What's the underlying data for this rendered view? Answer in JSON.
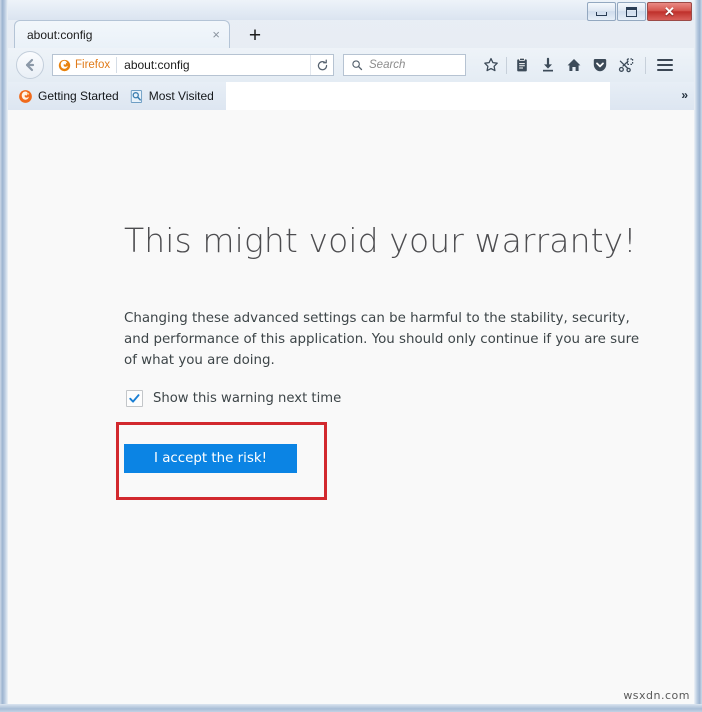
{
  "window": {
    "minimize_label": "Minimize",
    "maximize_label": "Maximize",
    "close_label": "✕"
  },
  "tabs": [
    {
      "title": "about:config",
      "close_glyph": "×"
    }
  ],
  "newtab_glyph": "+",
  "toolbar": {
    "back_label": "Back",
    "identity_label": "Firefox",
    "url_value": "about:config",
    "reload_glyph": "⟳",
    "search_placeholder": "Search",
    "icons": [
      {
        "name": "bookmark-star-icon",
        "label": "Bookmark this page"
      },
      {
        "name": "reading-list-icon",
        "label": "Reading list"
      },
      {
        "name": "downloads-icon",
        "label": "Downloads"
      },
      {
        "name": "home-icon",
        "label": "Home"
      },
      {
        "name": "pocket-icon",
        "label": "Save to Pocket"
      },
      {
        "name": "screenshot-scissors-icon",
        "label": "Take a screenshot"
      }
    ],
    "menu_label": "Open menu"
  },
  "bookmarks": {
    "items": [
      {
        "label": "Getting Started",
        "icon": "firefox-icon"
      },
      {
        "label": "Most Visited",
        "icon": "most-visited-icon"
      }
    ],
    "overflow_glyph": "»"
  },
  "page": {
    "heading": "This might void your warranty!",
    "paragraph": "Changing these advanced settings can be harmful to the stability, security, and performance of this application. You should only continue if you are sure of what you are doing.",
    "checkbox_label": "Show this warning next time",
    "checkbox_checked": true,
    "checkmark_glyph": "✓",
    "accept_button_label": "I accept the risk!"
  },
  "colors": {
    "accept_button_bg": "#0b84e4",
    "annotation_border": "#d2292e",
    "checkmark": "#1a7fd4",
    "identity_text": "#e07b1a",
    "content_bg": "#f9f9f9"
  },
  "watermark": "wsxdn.com"
}
